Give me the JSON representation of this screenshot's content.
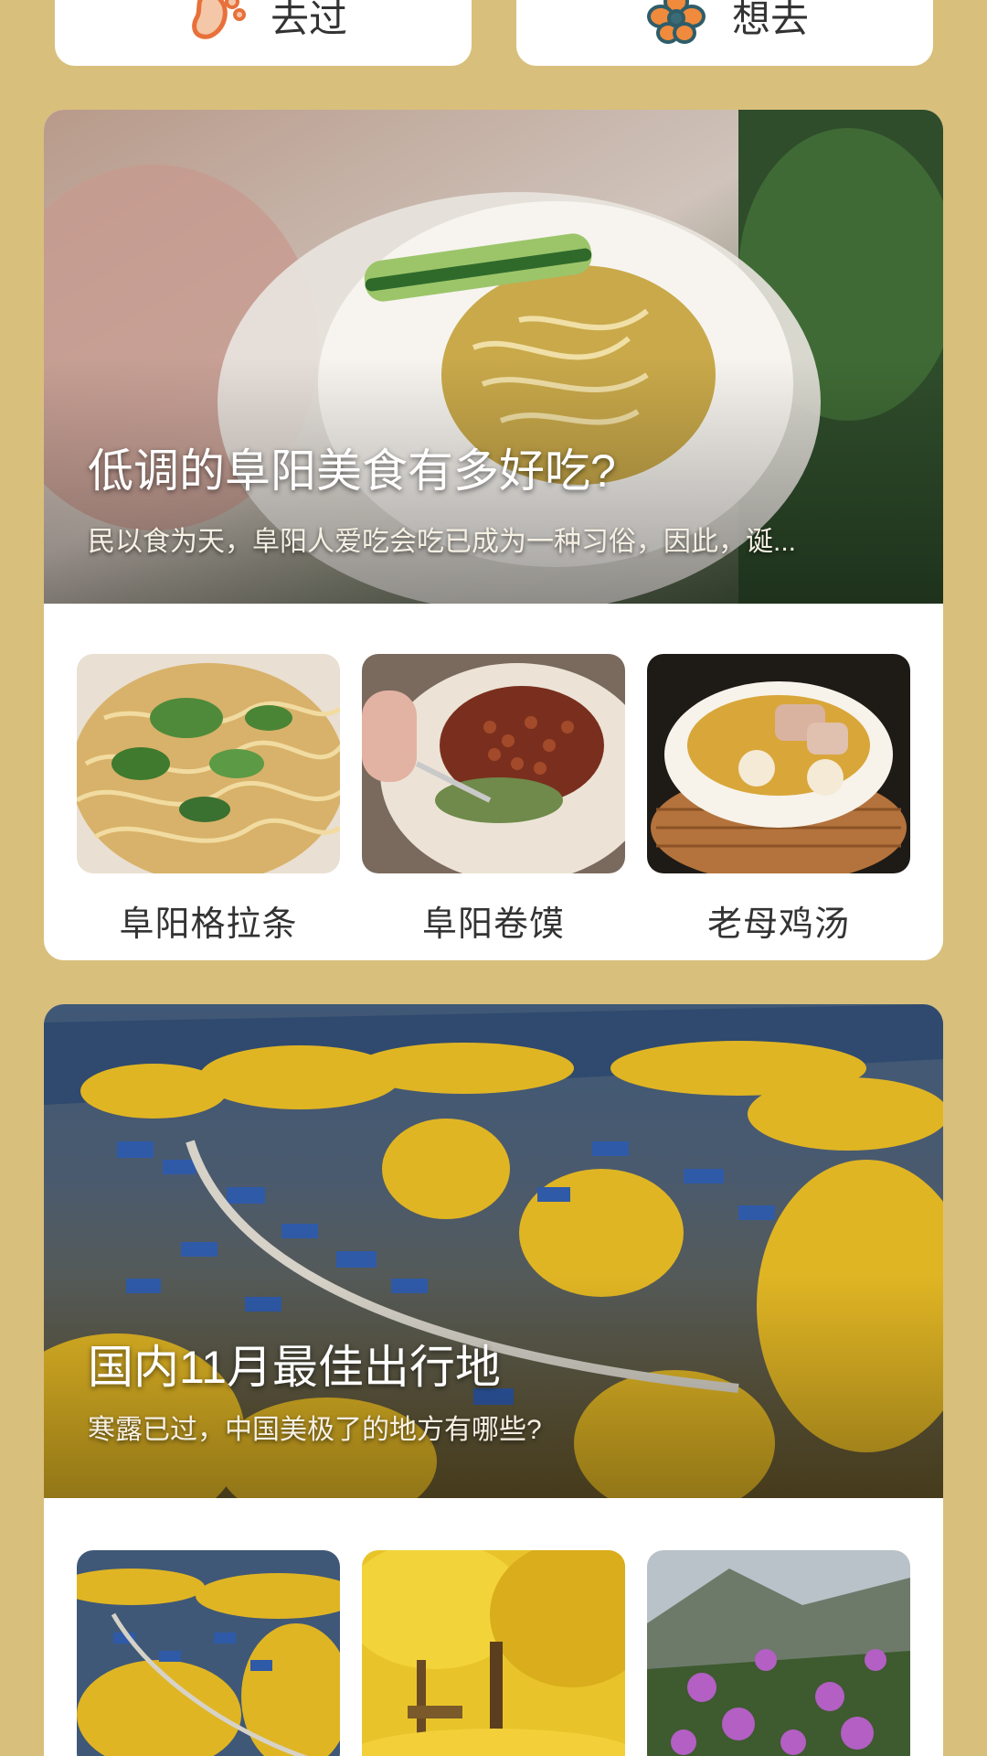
{
  "top_buttons": [
    {
      "label": "去过",
      "icon": "footprint-icon"
    },
    {
      "label": "想去",
      "icon": "flower-icon"
    }
  ],
  "cards": [
    {
      "title": "低调的阜阳美食有多好吃?",
      "subtitle": "民以食为天，阜阳人爱吃会吃已成为一种习俗，因此，诞...",
      "items": [
        {
          "label": "阜阳格拉条"
        },
        {
          "label": "阜阳卷馍"
        },
        {
          "label": "老母鸡汤"
        }
      ]
    },
    {
      "title": "国内11月最佳出行地",
      "subtitle": "寒露已过，中国美极了的地方有哪些?",
      "items": []
    }
  ],
  "colors": {
    "background": "#d9bf7c",
    "card": "#ffffff",
    "label_text": "#333333"
  }
}
